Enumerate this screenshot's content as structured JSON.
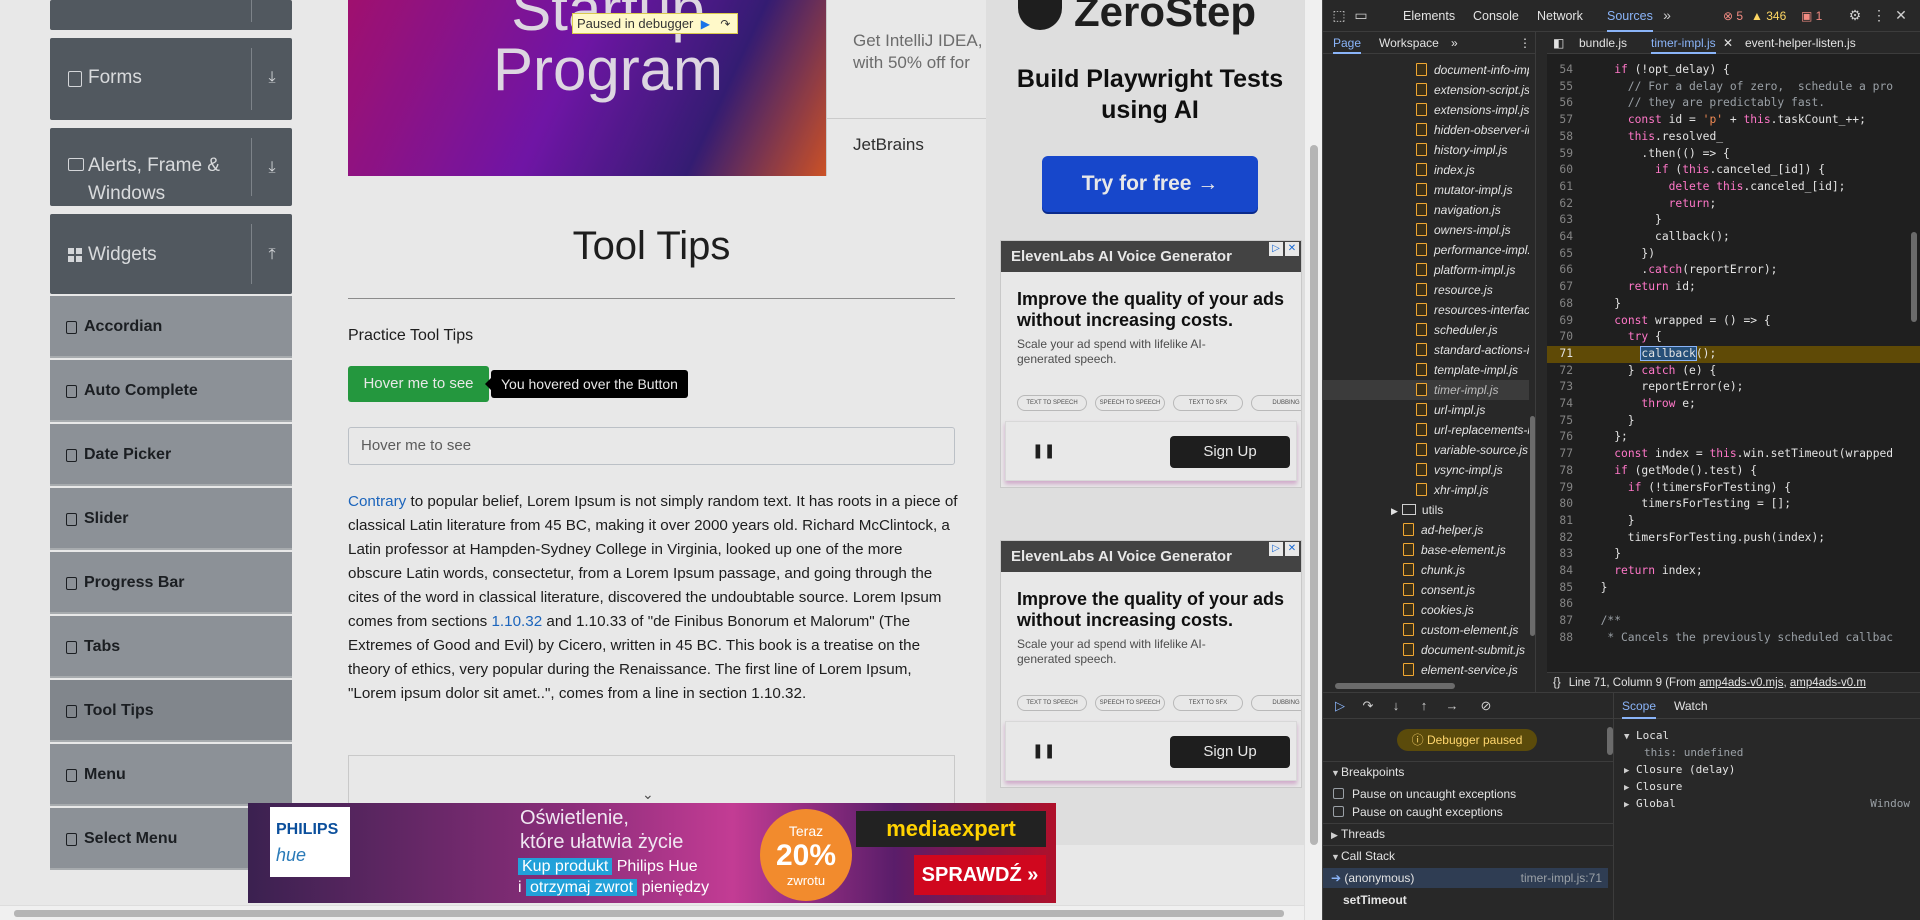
{
  "sidebar": {
    "groups": [
      {
        "label": "Forms"
      },
      {
        "label": "Alerts, Frame &\nWindows"
      },
      {
        "label": "Widgets"
      }
    ],
    "items": [
      {
        "label": "Accordian"
      },
      {
        "label": "Auto Complete"
      },
      {
        "label": "Date Picker"
      },
      {
        "label": "Slider"
      },
      {
        "label": "Progress Bar"
      },
      {
        "label": "Tabs"
      },
      {
        "label": "Tool Tips"
      },
      {
        "label": "Menu"
      },
      {
        "label": "Select Menu"
      }
    ]
  },
  "hero_ad": {
    "big_text": "Startup\nProgram",
    "side_text": "Get IntelliJ IDEA, with 50% off for",
    "brand": "JetBrains"
  },
  "debugger_banner": {
    "label": "Paused in debugger"
  },
  "main": {
    "heading": "Tool Tips",
    "practice_label": "Practice Tool Tips",
    "hover_button": "Hover me to see",
    "tooltip": "You hovered over the Button",
    "hover_input_placeholder": "Hover me to see",
    "lorem": {
      "link1": "Contrary",
      "part1": " to popular belief, Lorem Ipsum is not simply random text. It has roots in a piece of classical Latin literature from 45 BC, making it over 2000 years old. Richard McClintock, a Latin professor at Hampden-Sydney College in Virginia, looked up one of the more obscure Latin words, consectetur, from a Lorem Ipsum passage, and going through the cites of the word in classical literature, discovered the undoubtable source. Lorem Ipsum comes from sections ",
      "link2": "1.10.32",
      "part2": " and 1.10.33 of \"de Finibus Bonorum et Malorum\" (The Extremes of Good and Evil) by Cicero, written in 45 BC. This book is a treatise on the theory of ethics, very popular during the Renaissance. The first line of Lorem Ipsum, \"Lorem ipsum dolor sit amet..\", comes from a line in section 1.10.32."
    }
  },
  "zerostep_ad": {
    "logo": "ZeroStep",
    "title": "Build Playwright Tests using AI",
    "button": "Try for free →"
  },
  "elevenlabs_ads": [
    {
      "head": "ElevenLabs AI Voice Generator",
      "big": "Improve the quality of your ads without increasing costs.",
      "small": "Scale your ad spend with lifelike AI-generated speech.",
      "chips": [
        "TEXT TO SPEECH",
        "SPEECH TO SPEECH",
        "TEXT TO SFX",
        "DUBBING"
      ],
      "signup": "Sign Up"
    },
    {
      "head": "ElevenLabs AI Voice Generator",
      "big": "Improve the quality of your ads without increasing costs.",
      "small": "Scale your ad spend with lifelike AI-generated speech.",
      "chips": [
        "TEXT TO SPEECH",
        "SPEECH TO SPEECH",
        "TEXT TO SFX",
        "DUBBING"
      ],
      "signup": "Sign Up"
    }
  ],
  "bottom_ad": {
    "brand1": "PHILIPS",
    "brand2": "hue",
    "line1": "Oświetlenie,\nktóre ułatwia życie",
    "line2_hl": "Kup produkt",
    "line2_rest": " Philips Hue",
    "line3_pre": "i ",
    "line3_hl": "otrzymaj zwrot",
    "line3_rest": " pieniędzy",
    "badge_top": "Teraz",
    "badge_pct": "20%",
    "badge_bottom": "zwrotu",
    "store": "mediaexpert",
    "cta": "SPRAWDŹ »"
  },
  "devtools": {
    "tabs": [
      "Elements",
      "Console",
      "Network",
      "Sources"
    ],
    "active_tab": "Sources",
    "errors": "5",
    "warnings": "346",
    "issues": "1",
    "nav_tabs": [
      "Page",
      "Workspace"
    ],
    "files": [
      "document-info-impl.js",
      "extension-script.js",
      "extensions-impl.js",
      "hidden-observer-impl.js",
      "history-impl.js",
      "index.js",
      "mutator-impl.js",
      "navigation.js",
      "owners-impl.js",
      "performance-impl.js",
      "platform-impl.js",
      "resource.js",
      "resources-interface.js",
      "scheduler.js",
      "standard-actions-impl.js",
      "template-impl.js",
      "timer-impl.js",
      "url-impl.js",
      "url-replacements-impl.js",
      "variable-source.js",
      "vsync-impl.js",
      "xhr-impl.js"
    ],
    "folder": "utils",
    "utils_files": [
      "ad-helper.js",
      "base-element.js",
      "chunk.js",
      "consent.js",
      "cookies.js",
      "custom-element.js",
      "document-submit.js",
      "element-service.js"
    ],
    "editor_tabs": [
      "bundle.js",
      "timer-impl.js",
      "event-helper-listen.js"
    ],
    "code": [
      {
        "n": "54",
        "t": "    if (!opt_delay) {"
      },
      {
        "n": "55",
        "t": "      // For a delay of zero,  schedule a pro"
      },
      {
        "n": "56",
        "t": "      // they are predictably fast."
      },
      {
        "n": "57",
        "t": "      const id = 'p' + this.taskCount_++;"
      },
      {
        "n": "58",
        "t": "      this.resolved_"
      },
      {
        "n": "59",
        "t": "        .then(() => {"
      },
      {
        "n": "60",
        "t": "          if (this.canceled_[id]) {"
      },
      {
        "n": "61",
        "t": "            delete this.canceled_[id];"
      },
      {
        "n": "62",
        "t": "            return;"
      },
      {
        "n": "63",
        "t": "          }"
      },
      {
        "n": "64",
        "t": "          callback();"
      },
      {
        "n": "65",
        "t": "        })"
      },
      {
        "n": "66",
        "t": "        .catch(reportError);"
      },
      {
        "n": "67",
        "t": "      return id;"
      },
      {
        "n": "68",
        "t": "    }"
      },
      {
        "n": "69",
        "t": "    const wrapped = () => {"
      },
      {
        "n": "70",
        "t": "      try {"
      },
      {
        "n": "71",
        "t": "        callback();"
      },
      {
        "n": "72",
        "t": "      } catch (e) {"
      },
      {
        "n": "73",
        "t": "        reportError(e);"
      },
      {
        "n": "74",
        "t": "        throw e;"
      },
      {
        "n": "75",
        "t": "      }"
      },
      {
        "n": "76",
        "t": "    };"
      },
      {
        "n": "77",
        "t": "    const index = this.win.setTimeout(wrapped"
      },
      {
        "n": "78",
        "t": "    if (getMode().test) {"
      },
      {
        "n": "79",
        "t": "      if (!timersForTesting) {"
      },
      {
        "n": "80",
        "t": "        timersForTesting = [];"
      },
      {
        "n": "81",
        "t": "      }"
      },
      {
        "n": "82",
        "t": "      timersForTesting.push(index);"
      },
      {
        "n": "83",
        "t": "    }"
      },
      {
        "n": "84",
        "t": "    return index;"
      },
      {
        "n": "85",
        "t": "  }"
      },
      {
        "n": "86",
        "t": ""
      },
      {
        "n": "87",
        "t": "  /**"
      },
      {
        "n": "88",
        "t": "   * Cancels the previously scheduled callbac"
      }
    ],
    "highlighted_line": "71",
    "status_prefix": "Line 71, Column 9  (From ",
    "status_link1": "amp4ads-v0.mjs",
    "status_sep": ", ",
    "status_link2": "amp4ads-v0.m",
    "paused_label": "Debugger paused",
    "breakpoints_label": "Breakpoints",
    "pause_uncaught": "Pause on uncaught exceptions",
    "pause_caught": "Pause on caught exceptions",
    "threads_label": "Threads",
    "callstack_label": "Call Stack",
    "stack": [
      {
        "fn": "(anonymous)",
        "loc": "timer-impl.js:71"
      },
      {
        "fn": "setTimeout",
        "loc": ""
      }
    ],
    "scope_tabs": [
      "Scope",
      "Watch"
    ],
    "scope": {
      "local": "Local",
      "this_row": "this: undefined",
      "closure_delay": "Closure (delay)",
      "closure": "Closure",
      "global": "Global",
      "global_val": "Window"
    }
  },
  "colors": {
    "accent": "#8ab4f8",
    "button_green": "#28a745",
    "sidebar_group": "#5a6169",
    "sidebar_item": "#9aa0a6"
  }
}
